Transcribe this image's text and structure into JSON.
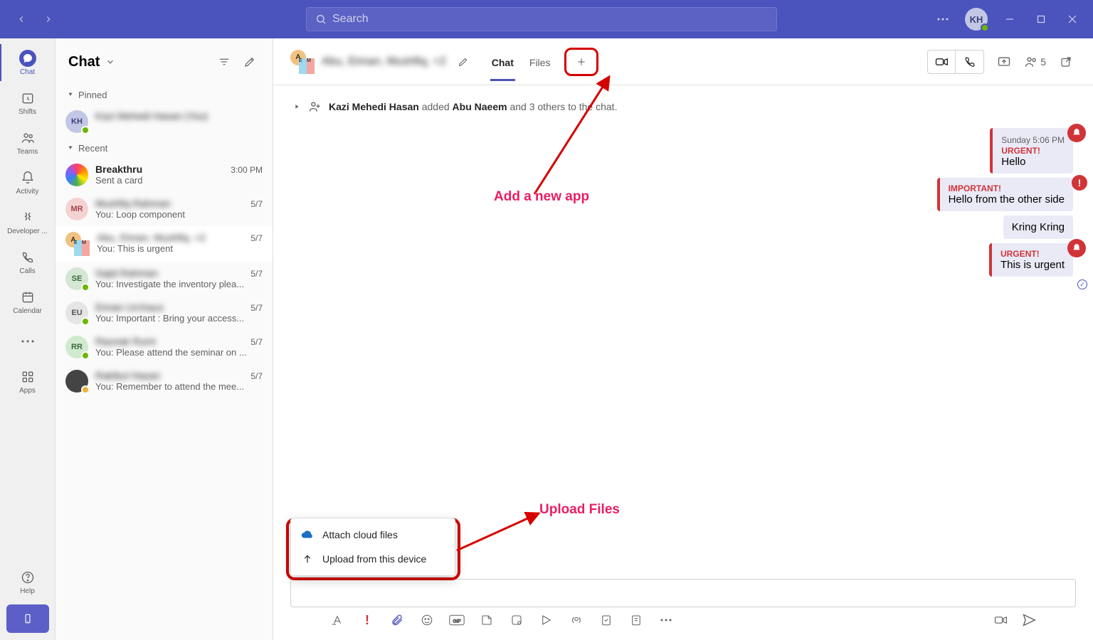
{
  "title_bar": {
    "search_placeholder": "Search",
    "avatar_initials": "KH"
  },
  "rail": {
    "items": [
      {
        "label": "Chat",
        "active": true
      },
      {
        "label": "Shifts"
      },
      {
        "label": "Teams"
      },
      {
        "label": "Activity"
      },
      {
        "label": "Developer ..."
      },
      {
        "label": "Calls"
      },
      {
        "label": "Calendar"
      }
    ],
    "more": "",
    "apps_label": "Apps",
    "help_label": "Help"
  },
  "panel": {
    "title": "Chat",
    "sections": {
      "pinned_label": "Pinned",
      "recent_label": "Recent"
    },
    "pinned": [
      {
        "initials": "KH",
        "name": "Kazi Mehedi Hasan (You)",
        "preview": "",
        "time": ""
      }
    ],
    "recent": [
      {
        "name": "Breakthru",
        "preview": "Sent a card",
        "time": "3:00 PM",
        "avatar": "breakthru"
      },
      {
        "initials": "MR",
        "name": "Mushfiq Rahman",
        "preview": "You: Loop component",
        "time": "5/7"
      },
      {
        "avatar": "group",
        "name": "Abu, Eiman, Mushfiq, +2",
        "preview": "You: This is urgent",
        "time": "5/7",
        "selected": true
      },
      {
        "initials": "SE",
        "name": "Sajid Rahman",
        "preview": "You: Investigate the inventory plea...",
        "time": "5/7"
      },
      {
        "initials": "EU",
        "name": "Eiman Urchaus",
        "preview": "You: Important : Bring your access...",
        "time": "5/7"
      },
      {
        "initials": "RR",
        "name": "Raunak Rumi",
        "preview": "You: Please attend the seminar on ...",
        "time": "5/7"
      },
      {
        "avatar": "pic",
        "name": "Rakibul Hasan",
        "preview": "You: Remember to attend the mee...",
        "time": "5/7"
      }
    ]
  },
  "chat_header": {
    "title": "Abu, Eiman, Mushfiq, +2",
    "tabs": {
      "chat": "Chat",
      "files": "Files"
    },
    "participants": "5"
  },
  "system_message": {
    "actor": "Kazi Mehedi Hasan",
    "action": " added ",
    "target": "Abu Naeem",
    "suffix": " and 3 others to the chat."
  },
  "messages": [
    {
      "kind": "urgent",
      "label": "URGENT!",
      "time": "Sunday 5:06 PM",
      "text": "Hello"
    },
    {
      "kind": "important",
      "label": "IMPORTANT!",
      "text": "Hello from the other side"
    },
    {
      "kind": "plain",
      "text": "Kring Kring"
    },
    {
      "kind": "urgent",
      "label": "URGENT!",
      "text": "This is urgent",
      "seen": true
    }
  ],
  "attach_menu": {
    "cloud": "Attach cloud files",
    "device": "Upload from this device"
  },
  "annotations": {
    "add_app": "Add a new app",
    "upload": "Upload Files"
  }
}
